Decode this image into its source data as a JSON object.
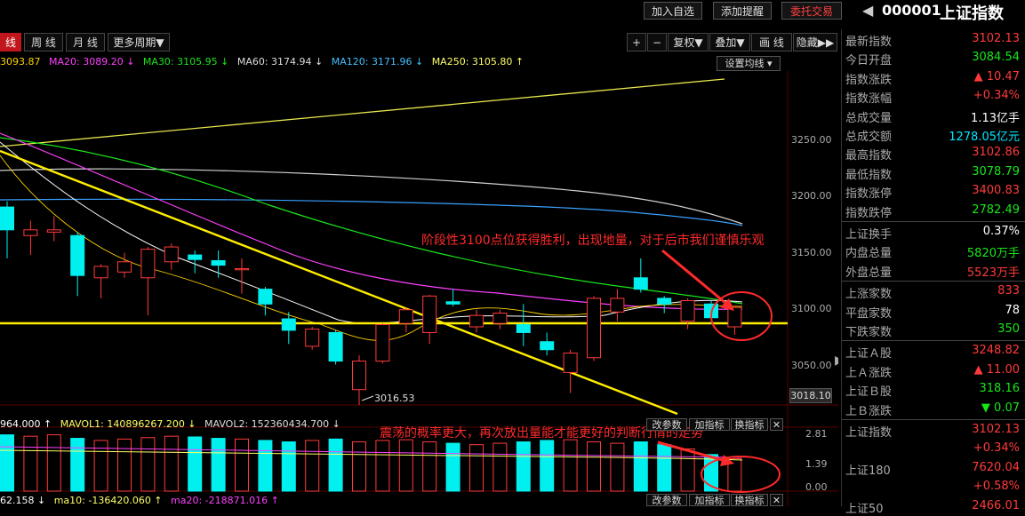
{
  "topbar": {
    "add_watch": "加入自选",
    "add_alert": "添加提醒",
    "order": "委托交易",
    "stock_code": "000001",
    "stock_name": "上证指数",
    "back_glyph": "◀"
  },
  "toolbar": {
    "tabs": [
      "线",
      "周 线",
      "月 线",
      "更多周期▼"
    ],
    "right_buttons": [
      "+",
      "−",
      "复权▼",
      "叠加▼",
      "画 线",
      "隐藏▶▶"
    ]
  },
  "ma_line": {
    "ma5": "3093.87",
    "ma20": "MA20: 3089.20 ↓",
    "ma30": "MA30: 3105.95 ↓",
    "ma60": "MA60: 3174.94 ↓",
    "ma120": "MA120: 3171.96 ↓",
    "ma250": "MA250: 3105.80 ↑",
    "settings": "设置均线 ▾"
  },
  "price_axis": [
    "3250.00",
    "3200.00",
    "3150.00",
    "3100.00",
    "3050.00"
  ],
  "price_tag": "3018.10",
  "low_label": "3016.53",
  "annotations": {
    "main": "阶段性3100点位获得胜利，出现地量，对于后市我们谨慎乐观",
    "volume": "震荡的概率更大，再次放出量能才能更好的判断行情的走势"
  },
  "volume": {
    "vol": "964.000 ↑",
    "mavol1": "MAVOL1: 140896267.200 ↓",
    "mavol2": "MAVOL2: 152360434.700 ↓",
    "axis": [
      "2.81",
      "1.39",
      "0.00"
    ],
    "buttons": [
      "改参数",
      "加指标",
      "换指标",
      "✕"
    ]
  },
  "indicator": {
    "v1": "62.158 ↓",
    "ma10": "ma10: -136420.060 ↑",
    "ma20": "ma20: -218871.016 ↑",
    "buttons": [
      "改参数",
      "加指标",
      "换指标",
      "✕"
    ]
  },
  "panel": {
    "rows1": [
      {
        "label": "最新指数",
        "value": "3102.13",
        "cls": "red"
      },
      {
        "label": "今日开盘",
        "value": "3084.54",
        "cls": "green"
      },
      {
        "label": "指数涨跌",
        "value": "▲ 10.47",
        "cls": "red"
      },
      {
        "label": "指数涨幅",
        "value": "+0.34%",
        "cls": "red"
      },
      {
        "label": "总成交量",
        "value": "1.13亿手",
        "cls": "white"
      },
      {
        "label": "总成交额",
        "value": "1278.05亿元",
        "cls": "cyan"
      },
      {
        "label": "最高指数",
        "value": "3102.86",
        "cls": "red"
      },
      {
        "label": "最低指数",
        "value": "3078.79",
        "cls": "green"
      },
      {
        "label": "指数涨停",
        "value": "3400.83",
        "cls": "red"
      },
      {
        "label": "指数跌停",
        "value": "2782.49",
        "cls": "green"
      }
    ],
    "rows2": [
      {
        "label": "上证换手",
        "value": "0.37%",
        "cls": "white"
      },
      {
        "label": "内盘总量",
        "value": "5820万手",
        "cls": "green"
      },
      {
        "label": "外盘总量",
        "value": "5523万手",
        "cls": "red"
      }
    ],
    "rows3": [
      {
        "label": "上涨家数",
        "value": "833",
        "cls": "red"
      },
      {
        "label": "平盘家数",
        "value": "78",
        "cls": "white"
      },
      {
        "label": "下跌家数",
        "value": "350",
        "cls": "green"
      }
    ],
    "rows4": [
      {
        "label": "上证Ａ股",
        "value": "3248.82",
        "cls": "red"
      },
      {
        "label": "上Ａ涨跌",
        "value": "▲ 11.00",
        "cls": "red"
      },
      {
        "label": "上证Ｂ股",
        "value": "318.16",
        "cls": "green"
      },
      {
        "label": "上Ｂ涨跌",
        "value": "▼ 0.07",
        "cls": "green"
      }
    ],
    "rows5": [
      {
        "label": "上证指数",
        "value": "3102.13",
        "cls": "red"
      },
      {
        "label": "",
        "value": "+0.34%",
        "cls": "red"
      },
      {
        "label": "上证180",
        "value": "7620.04",
        "cls": "red"
      },
      {
        "label": "",
        "value": "+0.58%",
        "cls": "red"
      },
      {
        "label": "上证50",
        "value": "2466.01",
        "cls": "red"
      }
    ]
  },
  "chart_data": {
    "type": "candlestick",
    "ylim": [
      3010,
      3285
    ],
    "candles": [
      {
        "o": 3170,
        "h": 3195,
        "l": 3145,
        "c": 3190,
        "dir": "down"
      },
      {
        "o": 3165,
        "h": 3178,
        "l": 3148,
        "c": 3170,
        "dir": "up"
      },
      {
        "o": 3170,
        "h": 3182,
        "l": 3160,
        "c": 3168,
        "dir": "up"
      },
      {
        "o": 3165,
        "h": 3168,
        "l": 3112,
        "c": 3130,
        "dir": "down"
      },
      {
        "o": 3128,
        "h": 3140,
        "l": 3110,
        "c": 3138,
        "dir": "up"
      },
      {
        "o": 3133,
        "h": 3150,
        "l": 3128,
        "c": 3142,
        "dir": "up"
      },
      {
        "o": 3128,
        "h": 3155,
        "l": 3095,
        "c": 3153,
        "dir": "up"
      },
      {
        "o": 3142,
        "h": 3158,
        "l": 3135,
        "c": 3155,
        "dir": "up"
      },
      {
        "o": 3148,
        "h": 3152,
        "l": 3132,
        "c": 3144,
        "dir": "down"
      },
      {
        "o": 3143,
        "h": 3152,
        "l": 3128,
        "c": 3139,
        "dir": "down"
      },
      {
        "o": 3135,
        "h": 3145,
        "l": 3114,
        "c": 3136,
        "dir": "up"
      },
      {
        "o": 3118,
        "h": 3120,
        "l": 3095,
        "c": 3105,
        "dir": "down"
      },
      {
        "o": 3092,
        "h": 3098,
        "l": 3070,
        "c": 3082,
        "dir": "down"
      },
      {
        "o": 3068,
        "h": 3085,
        "l": 3065,
        "c": 3083,
        "dir": "up"
      },
      {
        "o": 3080,
        "h": 3082,
        "l": 3052,
        "c": 3055,
        "dir": "down"
      },
      {
        "o": 3030,
        "h": 3060,
        "l": 3016.53,
        "c": 3055,
        "dir": "up"
      },
      {
        "o": 3055,
        "h": 3088,
        "l": 3053,
        "c": 3087,
        "dir": "up"
      },
      {
        "o": 3088,
        "h": 3102,
        "l": 3080,
        "c": 3100,
        "dir": "up"
      },
      {
        "o": 3080,
        "h": 3113,
        "l": 3070,
        "c": 3112,
        "dir": "up"
      },
      {
        "o": 3107,
        "h": 3118,
        "l": 3103,
        "c": 3105,
        "dir": "down"
      },
      {
        "o": 3085,
        "h": 3100,
        "l": 3080,
        "c": 3095,
        "dir": "up"
      },
      {
        "o": 3088,
        "h": 3100,
        "l": 3083,
        "c": 3097,
        "dir": "up"
      },
      {
        "o": 3087,
        "h": 3105,
        "l": 3068,
        "c": 3080,
        "dir": "down"
      },
      {
        "o": 3072,
        "h": 3080,
        "l": 3060,
        "c": 3065,
        "dir": "down"
      },
      {
        "o": 3045,
        "h": 3065,
        "l": 3027,
        "c": 3062,
        "dir": "up"
      },
      {
        "o": 3058,
        "h": 3112,
        "l": 3055,
        "c": 3110,
        "dir": "up"
      },
      {
        "o": 3098,
        "h": 3118,
        "l": 3090,
        "c": 3110,
        "dir": "up"
      },
      {
        "o": 3128,
        "h": 3145,
        "l": 3115,
        "c": 3118,
        "dir": "down"
      },
      {
        "o": 3110,
        "h": 3112,
        "l": 3097,
        "c": 3105,
        "dir": "down"
      },
      {
        "o": 3090,
        "h": 3110,
        "l": 3083,
        "c": 3108,
        "dir": "up"
      },
      {
        "o": 3105,
        "h": 3108,
        "l": 3088,
        "c": 3093,
        "dir": "down"
      },
      {
        "o": 3085,
        "h": 3103,
        "l": 3078,
        "c": 3102,
        "dir": "up"
      }
    ],
    "volume_ratio": [
      0.8,
      0.78,
      0.8,
      0.75,
      0.72,
      0.74,
      0.76,
      0.78,
      0.77,
      0.75,
      0.74,
      0.72,
      0.7,
      0.72,
      0.74,
      0.7,
      0.72,
      0.73,
      0.7,
      0.68,
      0.66,
      0.68,
      0.7,
      0.72,
      0.73,
      0.7,
      0.68,
      0.7,
      0.66,
      0.6,
      0.52,
      0.46
    ]
  }
}
